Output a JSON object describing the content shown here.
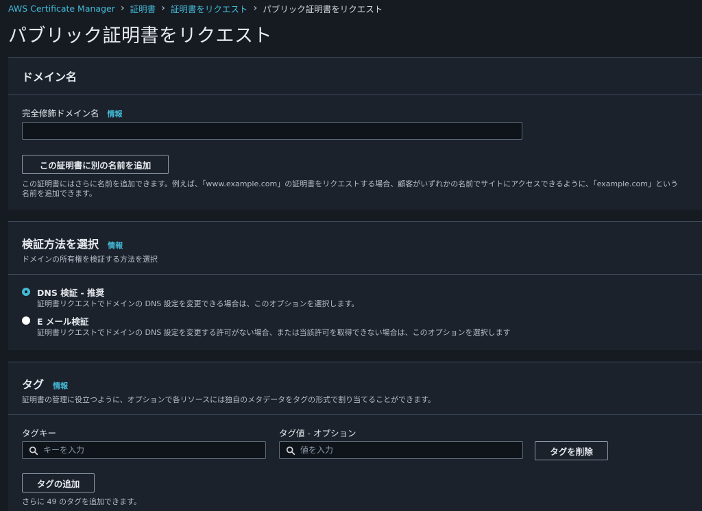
{
  "breadcrumb": {
    "items": [
      "AWS Certificate Manager",
      "証明書",
      "証明書をリクエスト"
    ],
    "current": "パブリック証明書をリクエスト"
  },
  "page_title": "パブリック証明書をリクエスト",
  "domain_section": {
    "title": "ドメイン名",
    "fqdn_label": "完全修飾ドメイン名",
    "info": "情報",
    "fqdn_value": "",
    "add_name_button": "この証明書に別の名前を追加",
    "help_line1": "この証明書にはさらに名前を追加できます。例えば、「www.example.com」の証明書をリクエストする場合、顧客がいずれかの名前でサイトにアクセスできるように、「example.com」という",
    "help_line2": "名前を追加できます。"
  },
  "validation_section": {
    "title": "検証方法を選択",
    "info": "情報",
    "subtitle": "ドメインの所有権を検証する方法を選択",
    "options": [
      {
        "label": "DNS 検証 - 推奨",
        "desc": "証明書リクエストでドメインの DNS 設定を変更できる場合は、このオプションを選択します。",
        "selected": true
      },
      {
        "label": "E メール検証",
        "desc": "証明書リクエストでドメインの DNS 設定を変更する許可がない場合、または当該許可を取得できない場合は、このオプションを選択します",
        "selected": false
      }
    ]
  },
  "tags_section": {
    "title": "タグ",
    "info": "情報",
    "subtitle": "証明書の管理に役立つように、オプションで各リソースには独自のメタデータをタグの形式で割り当てることができます。",
    "key_label": "タグキー",
    "key_placeholder": "キーを入力",
    "key_value": "",
    "value_label": "タグ値 - オプション",
    "value_placeholder": "値を入力",
    "value_value": "",
    "remove_button": "タグを削除",
    "add_button": "タグの追加",
    "remaining_note": "さらに 49 のタグを追加できます。"
  },
  "colors": {
    "link": "#44b9d6",
    "background": "#161b22",
    "panel": "#1b222c",
    "border": "#414d5c"
  }
}
